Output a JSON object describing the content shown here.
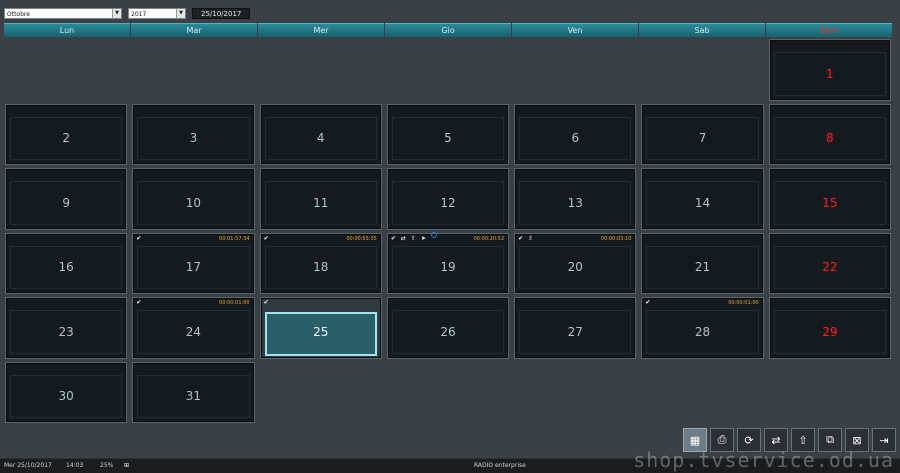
{
  "topbar": {
    "month": "Ottobre",
    "year": "2017",
    "date": "25/10/2017"
  },
  "weekdays": [
    "Lun",
    "Mar",
    "Mer",
    "Gio",
    "Ven",
    "Sab",
    "Dom"
  ],
  "calendar": {
    "days": [
      {
        "day": ""
      },
      {
        "day": ""
      },
      {
        "day": ""
      },
      {
        "day": ""
      },
      {
        "day": ""
      },
      {
        "day": ""
      },
      {
        "day": "1",
        "sun": true
      },
      {
        "day": "2"
      },
      {
        "day": "3"
      },
      {
        "day": "4"
      },
      {
        "day": "5"
      },
      {
        "day": "6"
      },
      {
        "day": "7"
      },
      {
        "day": "8",
        "sun": true
      },
      {
        "day": "9"
      },
      {
        "day": "10"
      },
      {
        "day": "11"
      },
      {
        "day": "12"
      },
      {
        "day": "13"
      },
      {
        "day": "14"
      },
      {
        "day": "15",
        "sun": true
      },
      {
        "day": "16"
      },
      {
        "day": "17",
        "icons": [
          "check-icon"
        ],
        "time": "00:01:57:34"
      },
      {
        "day": "18",
        "icons": [
          "check-icon"
        ],
        "time": "00:00:55:35"
      },
      {
        "day": "19",
        "icons": [
          "check-icon",
          "swap-icon",
          "upload-icon",
          "cursor-icon"
        ],
        "time": "00:00:20:52",
        "dot": true
      },
      {
        "day": "20",
        "icons": [
          "check-icon",
          "upload-icon"
        ],
        "time": "00:00:03:10"
      },
      {
        "day": "21"
      },
      {
        "day": "22",
        "sun": true
      },
      {
        "day": "23"
      },
      {
        "day": "24",
        "icons": [
          "check-icon"
        ],
        "time": "00:00:01:00"
      },
      {
        "day": "25",
        "icons": [
          "check-icon"
        ],
        "selected": true
      },
      {
        "day": "26"
      },
      {
        "day": "27"
      },
      {
        "day": "28",
        "icons": [
          "check-icon"
        ],
        "time": "00:00:01:00"
      },
      {
        "day": "29",
        "sun": true
      },
      {
        "day": "30"
      },
      {
        "day": "31"
      },
      {
        "day": ""
      },
      {
        "day": ""
      },
      {
        "day": ""
      },
      {
        "day": ""
      },
      {
        "day": ""
      }
    ]
  },
  "icon_glyphs": {
    "check-icon": "✔",
    "swap-icon": "⇄",
    "upload-icon": "⇧",
    "cursor-icon": "➤"
  },
  "toolbar": {
    "buttons": [
      {
        "name": "calendar-icon",
        "glyph": "▦"
      },
      {
        "name": "print-icon",
        "glyph": "⎙"
      },
      {
        "name": "refresh-icon",
        "glyph": "⟳"
      },
      {
        "name": "swap-icon",
        "glyph": "⇄"
      },
      {
        "name": "upload-icon",
        "glyph": "⇧"
      },
      {
        "name": "copy-icon",
        "glyph": "⧉"
      },
      {
        "name": "delete-list-icon",
        "glyph": "⊠"
      },
      {
        "name": "exit-icon",
        "glyph": "⇥"
      }
    ]
  },
  "status": {
    "date": "Mer 25/10/2017",
    "time": "14:03",
    "zoom": "25%",
    "app": "RADIO enterprise"
  },
  "watermark": "shop.tvservice.od.ua",
  "colors": {
    "accent": "#1f7b88",
    "sunday": "#ff2020",
    "time": "#e3a63a",
    "selected": "#9fe6ee"
  }
}
